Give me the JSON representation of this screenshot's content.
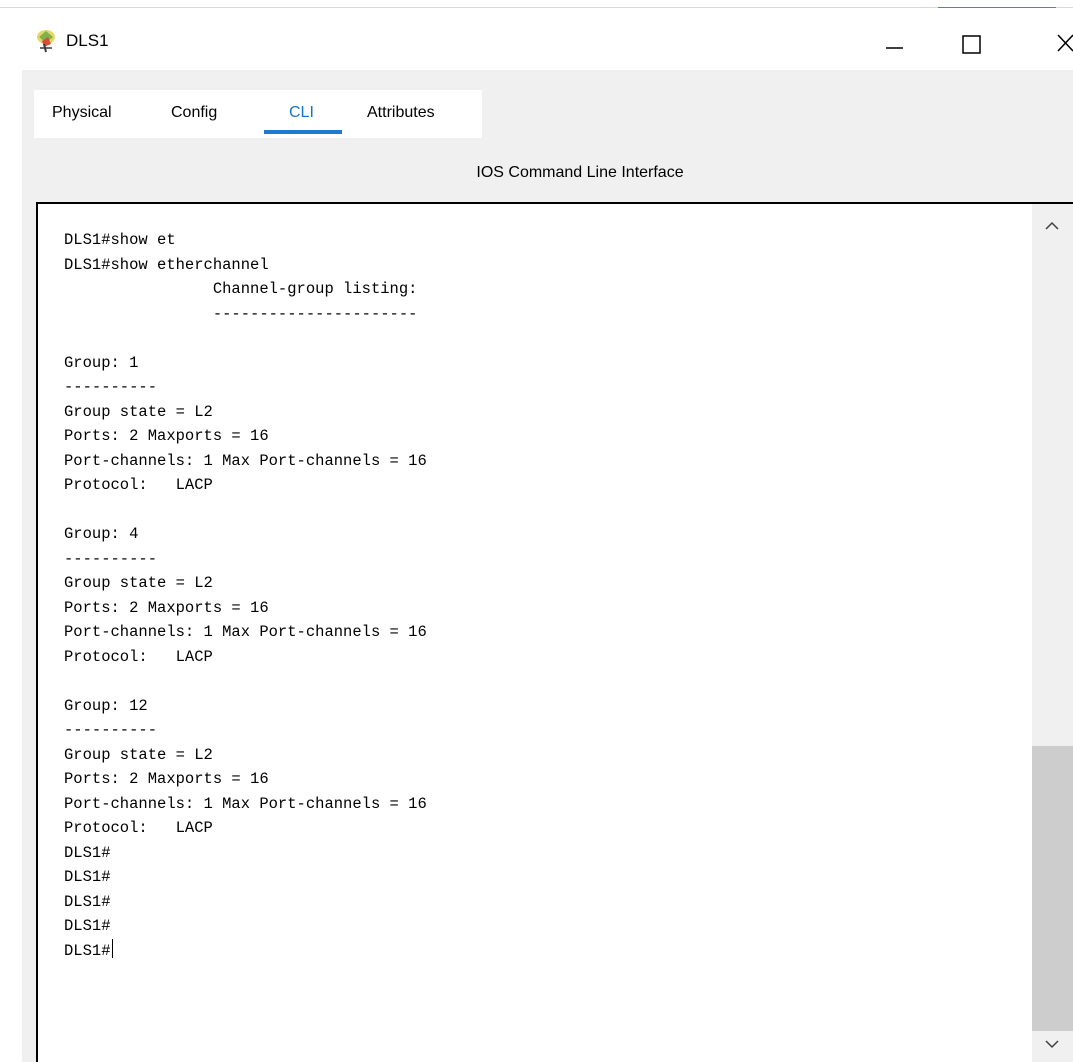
{
  "window": {
    "title": "DLS1",
    "icon": "network-device-icon",
    "controls": [
      "minimize-icon",
      "maximize-icon",
      "close-icon"
    ]
  },
  "tabs": [
    {
      "label": "Physical",
      "active": false
    },
    {
      "label": "Config",
      "active": false
    },
    {
      "label": "CLI",
      "active": true
    },
    {
      "label": "Attributes",
      "active": false
    }
  ],
  "panel": {
    "title": "IOS Command Line Interface"
  },
  "terminal": {
    "lines": [
      "DLS1#show et",
      "DLS1#show etherchannel",
      "                Channel-group listing:",
      "                ----------------------",
      "",
      "Group: 1",
      "----------",
      "Group state = L2",
      "Ports: 2 Maxports = 16",
      "Port-channels: 1 Max Port-channels = 16",
      "Protocol:   LACP",
      "",
      "Group: 4",
      "----------",
      "Group state = L2",
      "Ports: 2 Maxports = 16",
      "Port-channels: 1 Max Port-channels = 16",
      "Protocol:   LACP",
      "",
      "Group: 12",
      "----------",
      "Group state = L2",
      "Ports: 2 Maxports = 16",
      "Port-channels: 1 Max Port-channels = 16",
      "Protocol:   LACP",
      "DLS1#",
      "DLS1#",
      "DLS1#",
      "DLS1#",
      "DLS1#"
    ]
  },
  "colors": {
    "accent": "#1e7ad0",
    "panel_bg": "#f0f0f0",
    "terminal_bg": "#ffffff",
    "scroll_thumb": "#cdcdcd"
  }
}
